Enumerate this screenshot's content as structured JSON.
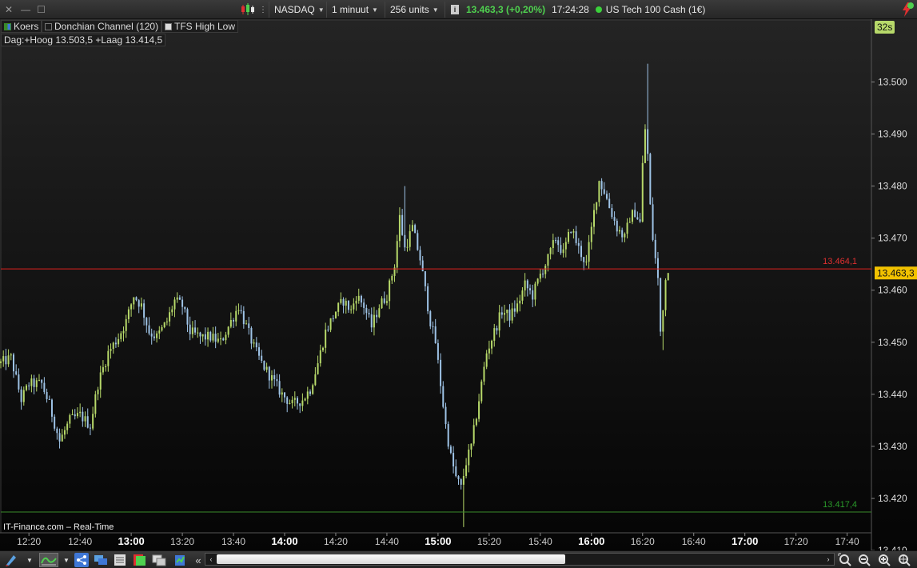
{
  "toolbar": {
    "close_icon": "close-icon",
    "minimize_icon": "minimize-icon",
    "restore_icon": "restore-icon",
    "instrument": "NASDAQ",
    "interval": "1 minuut",
    "units": "256 units",
    "quote_price": "13.463,3 (+0,20%)",
    "quote_time": "17:24:28",
    "instrument_name": "US Tech 100 Cash (1€)"
  },
  "legend": {
    "koers": "Koers",
    "donchian": "Donchian Channel (120)",
    "tfs": "TFS High Low",
    "dag": "Dag:+Hoog 13.503,5 +Laag 13.414,5"
  },
  "timer": "32s",
  "watermark": "IT-Finance.com – Real-Time",
  "colors": {
    "up_candle": "#b7d96a",
    "down_candle": "#9ec3e6",
    "high_line": "#e0201f",
    "low_line": "#3a8a2a",
    "price_tag_bg": "#f2c200",
    "high_label": "#e03030",
    "low_label": "#2a9a2a"
  },
  "chart_data": {
    "type": "candlestick",
    "ylim": [
      13413.4,
      13511.9
    ],
    "y_ticks": [
      "13.500",
      "13.490",
      "13.480",
      "13.470",
      "13.460",
      "13.450",
      "13.440",
      "13.430",
      "13.420",
      "13.410"
    ],
    "y_tick_values": [
      13500,
      13490,
      13480,
      13470,
      13460,
      13450,
      13440,
      13430,
      13420,
      13410
    ],
    "x_ticks": [
      {
        "label": "12:20",
        "bold": false
      },
      {
        "label": "12:40",
        "bold": false
      },
      {
        "label": "13:00",
        "bold": true
      },
      {
        "label": "13:20",
        "bold": false
      },
      {
        "label": "13:40",
        "bold": false
      },
      {
        "label": "14:00",
        "bold": true
      },
      {
        "label": "14:20",
        "bold": false
      },
      {
        "label": "14:40",
        "bold": false
      },
      {
        "label": "15:00",
        "bold": true
      },
      {
        "label": "15:20",
        "bold": false
      },
      {
        "label": "15:40",
        "bold": false
      },
      {
        "label": "16:00",
        "bold": true
      },
      {
        "label": "16:20",
        "bold": false
      },
      {
        "label": "16:40",
        "bold": false
      },
      {
        "label": "17:00",
        "bold": true
      },
      {
        "label": "17:20",
        "bold": false
      },
      {
        "label": "17:40",
        "bold": false
      }
    ],
    "x_tick_minutes": [
      740,
      760,
      780,
      800,
      820,
      840,
      860,
      880,
      900,
      920,
      940,
      960,
      980,
      1000,
      1020,
      1040,
      1060
    ],
    "x_range_minutes": [
      729,
      1069.5
    ],
    "high_line": {
      "value": 13464.1,
      "label": "13.464,1"
    },
    "low_line": {
      "value": 13417.4,
      "label": "13.417,4"
    },
    "last_price": {
      "value": 13463.3,
      "label": "13.463,3"
    },
    "price_path": [
      {
        "t": 729,
        "p": 13446
      },
      {
        "t": 733,
        "p": 13447
      },
      {
        "t": 737,
        "p": 13439
      },
      {
        "t": 740,
        "p": 13442
      },
      {
        "t": 745,
        "p": 13442
      },
      {
        "t": 748,
        "p": 13438
      },
      {
        "t": 752,
        "p": 13431
      },
      {
        "t": 756,
        "p": 13435
      },
      {
        "t": 760,
        "p": 13436
      },
      {
        "t": 764,
        "p": 13434
      },
      {
        "t": 767,
        "p": 13442
      },
      {
        "t": 771,
        "p": 13448
      },
      {
        "t": 775,
        "p": 13451
      },
      {
        "t": 778,
        "p": 13454
      },
      {
        "t": 781,
        "p": 13459
      },
      {
        "t": 784,
        "p": 13457
      },
      {
        "t": 787,
        "p": 13452
      },
      {
        "t": 790,
        "p": 13451
      },
      {
        "t": 794,
        "p": 13454
      },
      {
        "t": 797,
        "p": 13458
      },
      {
        "t": 800,
        "p": 13457
      },
      {
        "t": 803,
        "p": 13452
      },
      {
        "t": 807,
        "p": 13451
      },
      {
        "t": 811,
        "p": 13451
      },
      {
        "t": 815,
        "p": 13450
      },
      {
        "t": 819,
        "p": 13454
      },
      {
        "t": 822,
        "p": 13457
      },
      {
        "t": 825,
        "p": 13453
      },
      {
        "t": 828,
        "p": 13449
      },
      {
        "t": 831,
        "p": 13446
      },
      {
        "t": 835,
        "p": 13443
      },
      {
        "t": 839,
        "p": 13440
      },
      {
        "t": 843,
        "p": 13438
      },
      {
        "t": 847,
        "p": 13439
      },
      {
        "t": 850,
        "p": 13441
      },
      {
        "t": 853,
        "p": 13446
      },
      {
        "t": 856,
        "p": 13452
      },
      {
        "t": 860,
        "p": 13456
      },
      {
        "t": 863,
        "p": 13458
      },
      {
        "t": 866,
        "p": 13456
      },
      {
        "t": 868,
        "p": 13459
      },
      {
        "t": 871,
        "p": 13457
      },
      {
        "t": 874,
        "p": 13453
      },
      {
        "t": 877,
        "p": 13457
      },
      {
        "t": 880,
        "p": 13459
      },
      {
        "t": 883,
        "p": 13465
      },
      {
        "t": 885,
        "p": 13474
      },
      {
        "t": 887,
        "p": 13468
      },
      {
        "t": 890,
        "p": 13472
      },
      {
        "t": 893,
        "p": 13466
      },
      {
        "t": 895,
        "p": 13460
      },
      {
        "t": 897,
        "p": 13454
      },
      {
        "t": 899,
        "p": 13450
      },
      {
        "t": 901,
        "p": 13442
      },
      {
        "t": 903,
        "p": 13434
      },
      {
        "t": 905,
        "p": 13428
      },
      {
        "t": 907,
        "p": 13424
      },
      {
        "t": 909,
        "p": 13422
      },
      {
        "t": 911,
        "p": 13427
      },
      {
        "t": 913,
        "p": 13430
      },
      {
        "t": 915,
        "p": 13436
      },
      {
        "t": 917,
        "p": 13442
      },
      {
        "t": 919,
        "p": 13448
      },
      {
        "t": 922,
        "p": 13452
      },
      {
        "t": 925,
        "p": 13456
      },
      {
        "t": 928,
        "p": 13455
      },
      {
        "t": 931,
        "p": 13457
      },
      {
        "t": 934,
        "p": 13461
      },
      {
        "t": 937,
        "p": 13459
      },
      {
        "t": 940,
        "p": 13463
      },
      {
        "t": 943,
        "p": 13466
      },
      {
        "t": 946,
        "p": 13470
      },
      {
        "t": 949,
        "p": 13467
      },
      {
        "t": 952,
        "p": 13472
      },
      {
        "t": 955,
        "p": 13468
      },
      {
        "t": 958,
        "p": 13465
      },
      {
        "t": 961,
        "p": 13475
      },
      {
        "t": 963,
        "p": 13481
      },
      {
        "t": 965,
        "p": 13479
      },
      {
        "t": 967,
        "p": 13476
      },
      {
        "t": 970,
        "p": 13472
      },
      {
        "t": 973,
        "p": 13470
      },
      {
        "t": 975,
        "p": 13474
      },
      {
        "t": 977,
        "p": 13475
      },
      {
        "t": 979,
        "p": 13473
      },
      {
        "t": 980,
        "p": 13484
      },
      {
        "t": 981,
        "p": 13491
      },
      {
        "t": 982,
        "p": 13486
      },
      {
        "t": 983,
        "p": 13476
      },
      {
        "t": 984,
        "p": 13470
      },
      {
        "t": 985,
        "p": 13466
      },
      {
        "t": 986,
        "p": 13462
      },
      {
        "t": 987,
        "p": 13452
      },
      {
        "t": 988,
        "p": 13457
      },
      {
        "t": 989,
        "p": 13462
      },
      {
        "t": 990,
        "p": 13463.3
      }
    ]
  },
  "bottombar": {
    "scroll_left": "‹",
    "scroll_right": "›",
    "collapse": "«"
  }
}
